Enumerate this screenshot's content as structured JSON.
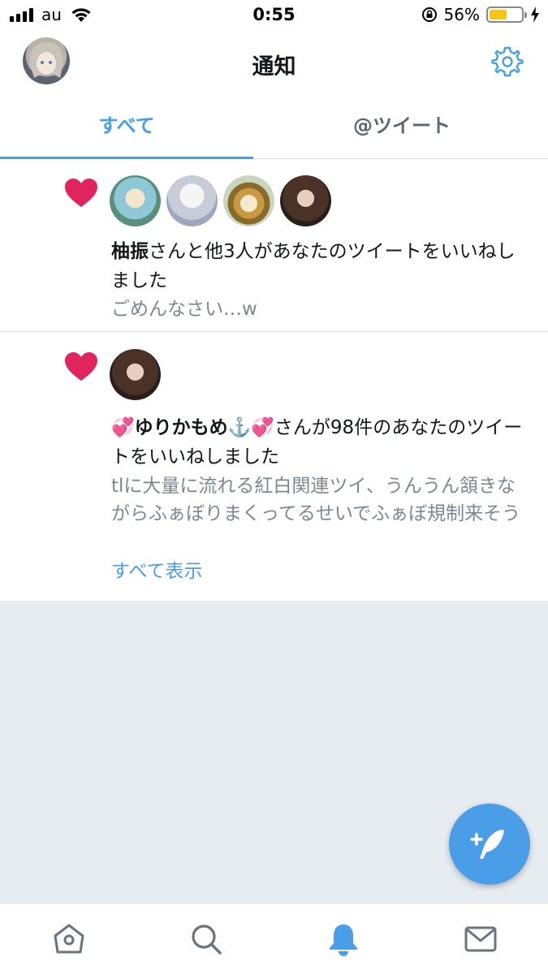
{
  "status_bar": {
    "carrier": "au",
    "time": "0:55",
    "battery_percent": "56%",
    "battery_level": 0.56
  },
  "header": {
    "title": "通知"
  },
  "tabs": [
    {
      "label": "すべて",
      "active": true
    },
    {
      "label": "@ツイート",
      "active": false
    }
  ],
  "notifications": [
    {
      "type": "like",
      "name": "柚振",
      "text": "さんと他3人があなたのツイートをいいねしました",
      "preview": "ごめんなさい…w"
    },
    {
      "type": "like",
      "name": "💞ゆりかもめ⚓️💞",
      "text": "さんが98件のあなたのツイートをいいねしました",
      "preview": "tlに大量に流れる紅白関連ツイ、うんうん頷きながらふぁぼりまくってるせいでふぁぼ規制来そう",
      "show_all": "すべて表示"
    }
  ],
  "icons": {
    "settings": "gear-icon",
    "compose": "compose-tweet-icon",
    "home": "home-icon",
    "search": "search-icon",
    "notifications": "bell-icon",
    "messages": "mail-icon"
  },
  "colors": {
    "accent": "#4a9ee8",
    "like": "#e0245e",
    "empty_background": "#e6ecf0"
  }
}
